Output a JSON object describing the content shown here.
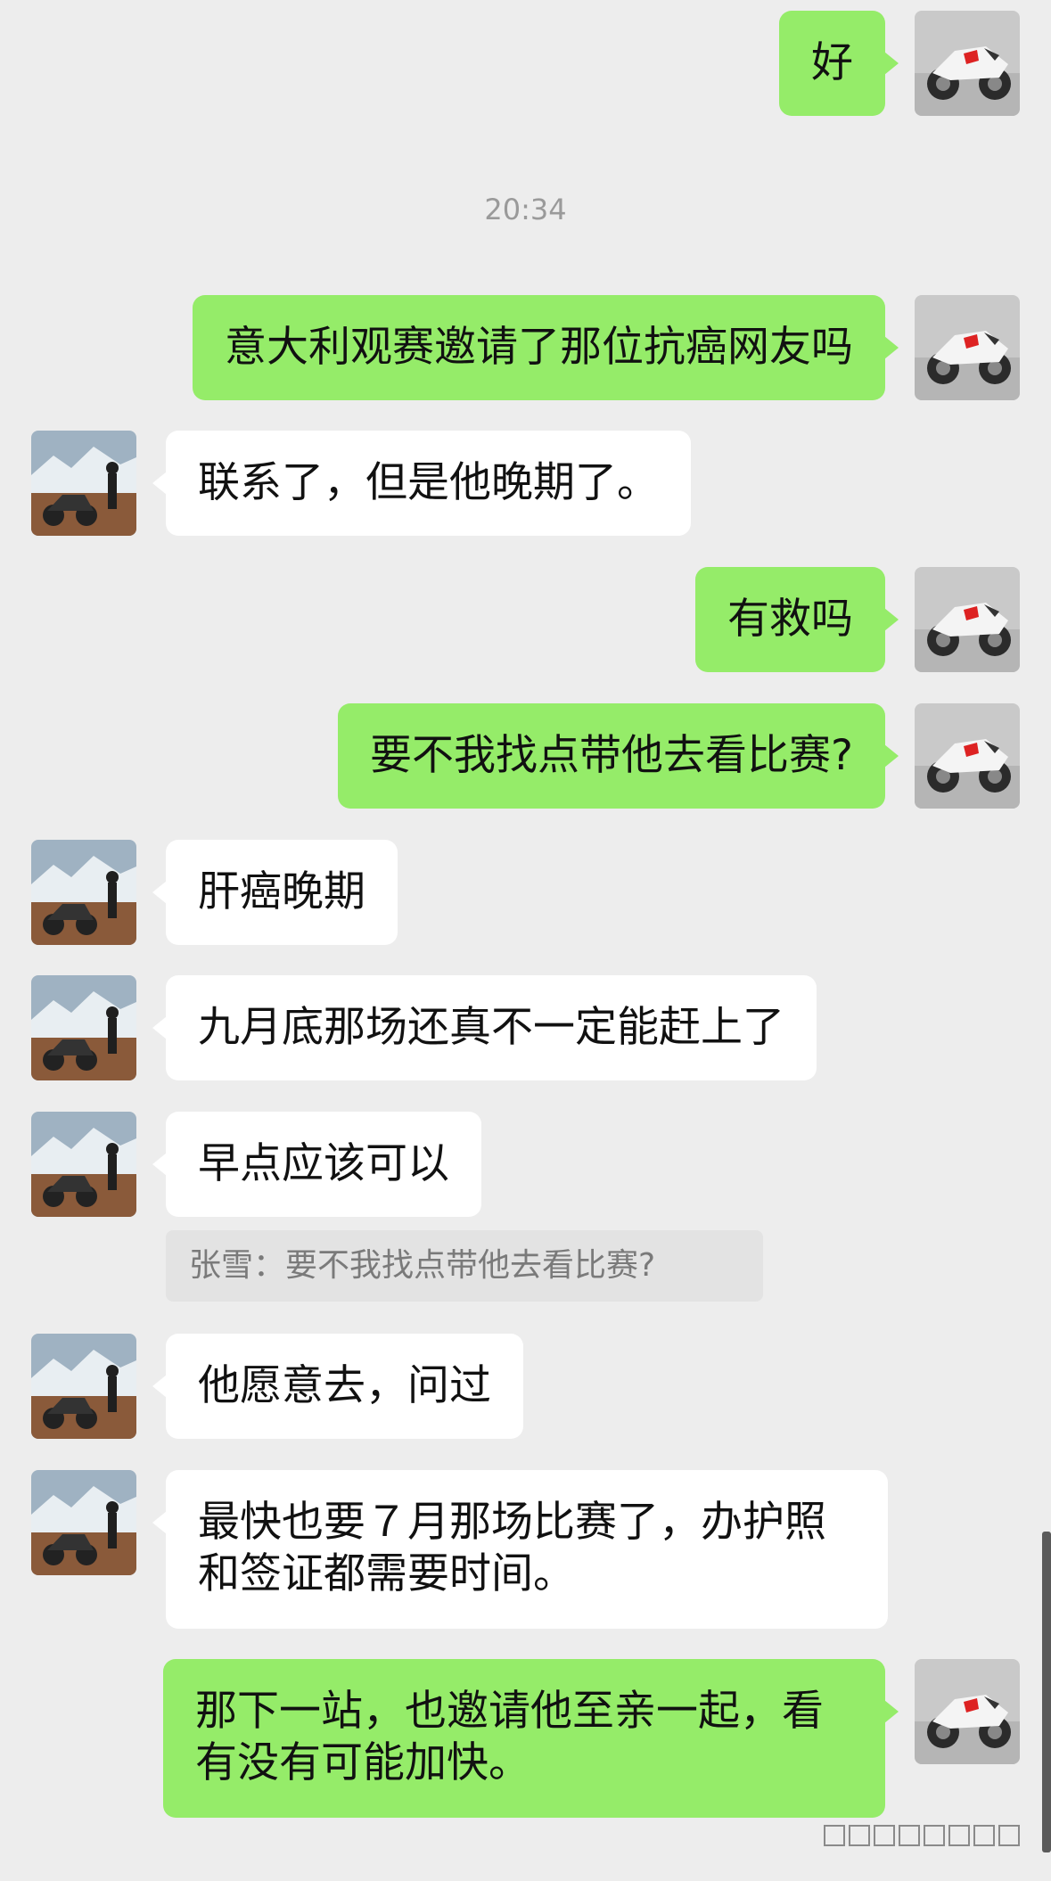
{
  "colors": {
    "background": "#ededed",
    "bubble_self": "#95ec69",
    "bubble_other": "#ffffff",
    "timestamp": "#9a9a9a",
    "quote_bg": "#e3e3e3"
  },
  "avatars": {
    "self": "motorcycle-avatar",
    "other": "rider-mountain-avatar"
  },
  "timestamp": "20:34",
  "messages": [
    {
      "sender": "self",
      "text": "好"
    },
    {
      "sender": "self",
      "text": "意大利观赛邀请了那位抗癌网友吗"
    },
    {
      "sender": "other",
      "text": "联系了，但是他晚期了。"
    },
    {
      "sender": "self",
      "text": "有救吗"
    },
    {
      "sender": "self",
      "text": "要不我找点带他去看比赛?"
    },
    {
      "sender": "other",
      "text": "肝癌晚期"
    },
    {
      "sender": "other",
      "text": "九月底那场还真不一定能赶上了"
    },
    {
      "sender": "other",
      "text": "早点应该可以"
    },
    {
      "sender": "other",
      "text": "他愿意去，问过"
    },
    {
      "sender": "other",
      "text": "最快也要７月那场比赛了，办护照和签证都需要时间。"
    },
    {
      "sender": "self",
      "text": "那下一站，也邀请他至亲一起，看有没有可能加快。"
    }
  ],
  "quote": "张雪：要不我找点带他去看比赛?"
}
